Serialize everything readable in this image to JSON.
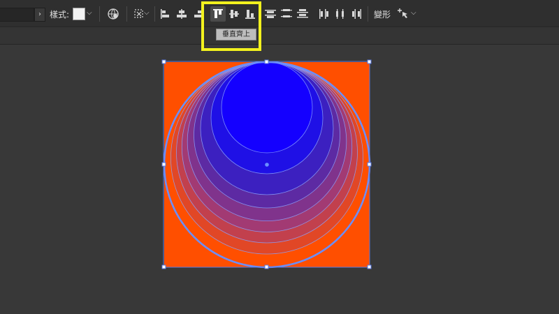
{
  "toolbar": {
    "style_label": "樣式:",
    "transform_label": "變形",
    "dropdown_caret": "⌵",
    "tooltip": "垂直齊上"
  },
  "colors": {
    "background": "#383838",
    "toolbar": "#2f2f2f",
    "artboard_fill": "#ff4f00",
    "gradient_start": "#1400ff",
    "gradient_end": "#ff4f00",
    "selection": "#6a8fff",
    "highlight": "#f2f11e"
  },
  "icons": [
    "globe-recolor-icon",
    "isolate-group-icon",
    "horizontal-align-left-icon",
    "horizontal-align-center-icon",
    "horizontal-align-right-icon",
    "vertical-align-top-icon",
    "vertical-align-center-icon",
    "vertical-align-bottom-icon",
    "vertical-distribute-top-icon",
    "vertical-distribute-center-icon",
    "vertical-distribute-bottom-icon",
    "horizontal-distribute-left-icon",
    "horizontal-distribute-center-icon",
    "horizontal-distribute-right-icon",
    "puppet-warp-icon"
  ],
  "artwork": {
    "blend_steps": 8,
    "selected": true
  }
}
